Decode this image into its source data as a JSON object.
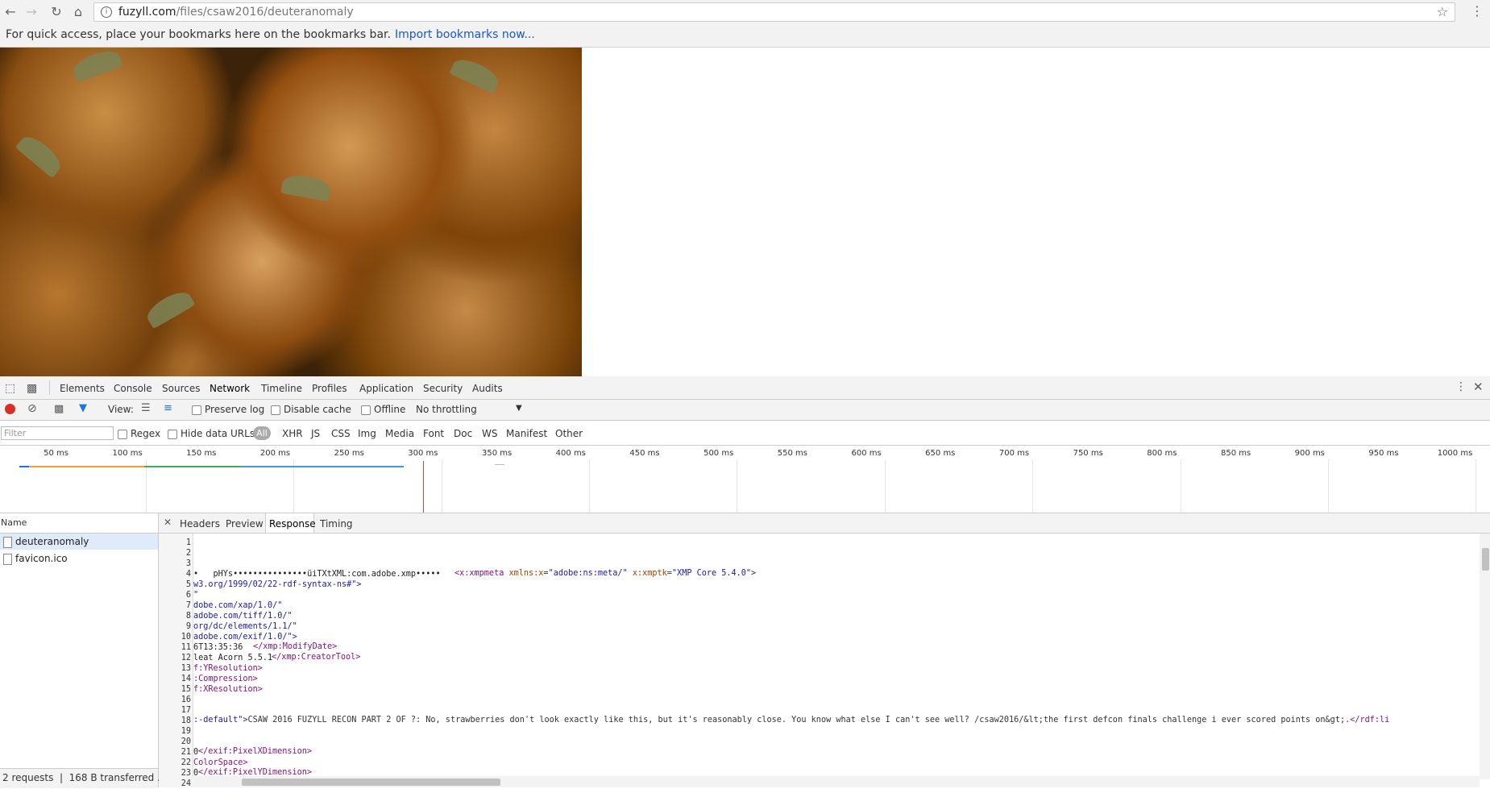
{
  "browser": {
    "url_host": "fuzyll.com",
    "url_path": "/files/csaw2016/deuteranomaly",
    "bookmarks_hint": "For quick access, place your bookmarks here on the bookmarks bar.",
    "bookmarks_link": "Import bookmarks now..."
  },
  "devtools": {
    "tabs": [
      "Elements",
      "Console",
      "Sources",
      "Network",
      "Timeline",
      "Profiles",
      "Application",
      "Security",
      "Audits"
    ],
    "active_tab": "Network",
    "toolbar": {
      "view_label": "View:",
      "preserve_log": "Preserve log",
      "disable_cache": "Disable cache",
      "offline": "Offline",
      "throttling": "No throttling"
    },
    "filter": {
      "placeholder": "Filter",
      "regex": "Regex",
      "hide_data_urls": "Hide data URLs",
      "all": "All",
      "types": [
        "XHR",
        "JS",
        "CSS",
        "Img",
        "Media",
        "Font",
        "Doc",
        "WS",
        "Manifest",
        "Other"
      ]
    },
    "timeline_ticks": [
      "50 ms",
      "100 ms",
      "150 ms",
      "200 ms",
      "250 ms",
      "300 ms",
      "350 ms",
      "400 ms",
      "450 ms",
      "500 ms",
      "550 ms",
      "600 ms",
      "650 ms",
      "700 ms",
      "750 ms",
      "800 ms",
      "850 ms",
      "900 ms",
      "950 ms",
      "1000 ms"
    ],
    "name_header": "Name",
    "requests": [
      "deuteranomaly",
      "favicon.ico"
    ],
    "status": "2 requests  |  168 B transferred ...",
    "detail_tabs": [
      "Headers",
      "Preview",
      "Response",
      "Timing"
    ],
    "active_detail_tab": "Response",
    "response_lines": [
      {
        "n": "1",
        "t": ""
      },
      {
        "n": "2",
        "t": ""
      },
      {
        "n": "3",
        "t": ""
      },
      {
        "n": "4",
        "t": "•   pHYs•••••••••••••••üiTXtXML:com.adobe.xmp•••••"
      },
      {
        "n": "5",
        "t": "w3.org/1999/02/22-rdf-syntax-ns#\">"
      },
      {
        "n": "6",
        "t": "\""
      },
      {
        "n": "7",
        "t": "dobe.com/xap/1.0/\""
      },
      {
        "n": "8",
        "t": "adobe.com/tiff/1.0/\""
      },
      {
        "n": "9",
        "t": "org/dc/elements/1.1/\""
      },
      {
        "n": "10",
        "t": "adobe.com/exif/1.0/\">"
      },
      {
        "n": "11",
        "t": "6T13:35:36"
      },
      {
        "n": "12",
        "t": "leat Acorn 5.5.1"
      },
      {
        "n": "13",
        "t": "f:YResolution>"
      },
      {
        "n": "14",
        "t": ":Compression>"
      },
      {
        "n": "15",
        "t": "f:XResolution>"
      },
      {
        "n": "16",
        "t": ""
      },
      {
        "n": "17",
        "t": ""
      },
      {
        "n": "18",
        "t": ""
      },
      {
        "n": "19",
        "t": ""
      },
      {
        "n": "20",
        "t": ""
      },
      {
        "n": "21",
        "t": "0"
      },
      {
        "n": "22",
        "t": "ColorSpace>"
      },
      {
        "n": "23",
        "t": "0"
      },
      {
        "n": "24",
        "t": ""
      }
    ],
    "xmp_tag": "<x:xmpmeta",
    "xmp_attr1": "xmlns:x",
    "xmp_val1": "\"adobe:ns:meta/\"",
    "xmp_attr2": "x:xmptk",
    "xmp_val2": "\"XMP Core 5.4.0\">",
    "modify_close": "</xmp:ModifyDate>",
    "creator_close": "</xmp:CreatorTool>",
    "line18_prefix": ":-default\">",
    "line18_text": "CSAW 2016 FUZYLL RECON PART 2 OF ?: No, strawberries don't look exactly like this, but it's reasonably close. You know what else I can't see well? /csaw2016/&lt;the first defcon finals challenge i ever scored points on&gt;.",
    "line18_suffix": "</rdf:li",
    "px_x_close": "</exif:PixelXDimension>",
    "px_y_close": "</exif:PixelYDimension>"
  },
  "colors": {
    "record": "#d93025",
    "link": "#1a57c4",
    "tag": "#881280",
    "attr": "#994500",
    "value": "#1a1aa6"
  }
}
